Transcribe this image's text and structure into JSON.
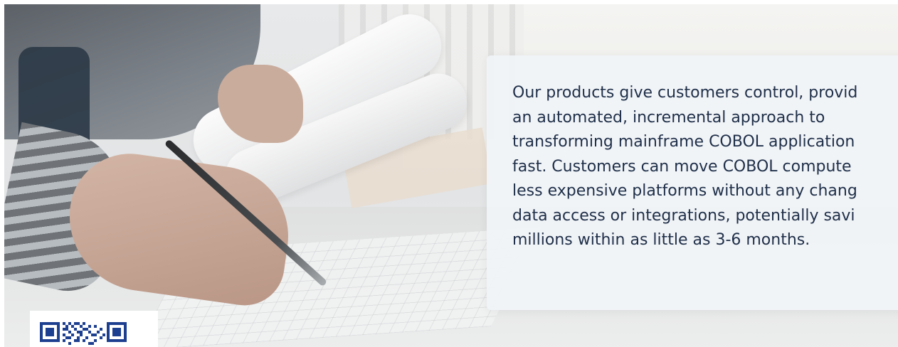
{
  "hero": {
    "image_icon": "blueprint-photo",
    "body_text": "Our products give customers control, provid\nan automated, incremental approach to\ntransforming mainframe COBOL application\nfast. Customers can move COBOL compute\nless expensive platforms without any chang\ndata access or integrations, potentially savi\nmillions within as little as 3-6 months."
  },
  "qr": {
    "icon": "qr-code-icon",
    "color": "#1d3f8f"
  },
  "colors": {
    "text": "#1f2f49",
    "card_bg": "#f1f4f7"
  }
}
